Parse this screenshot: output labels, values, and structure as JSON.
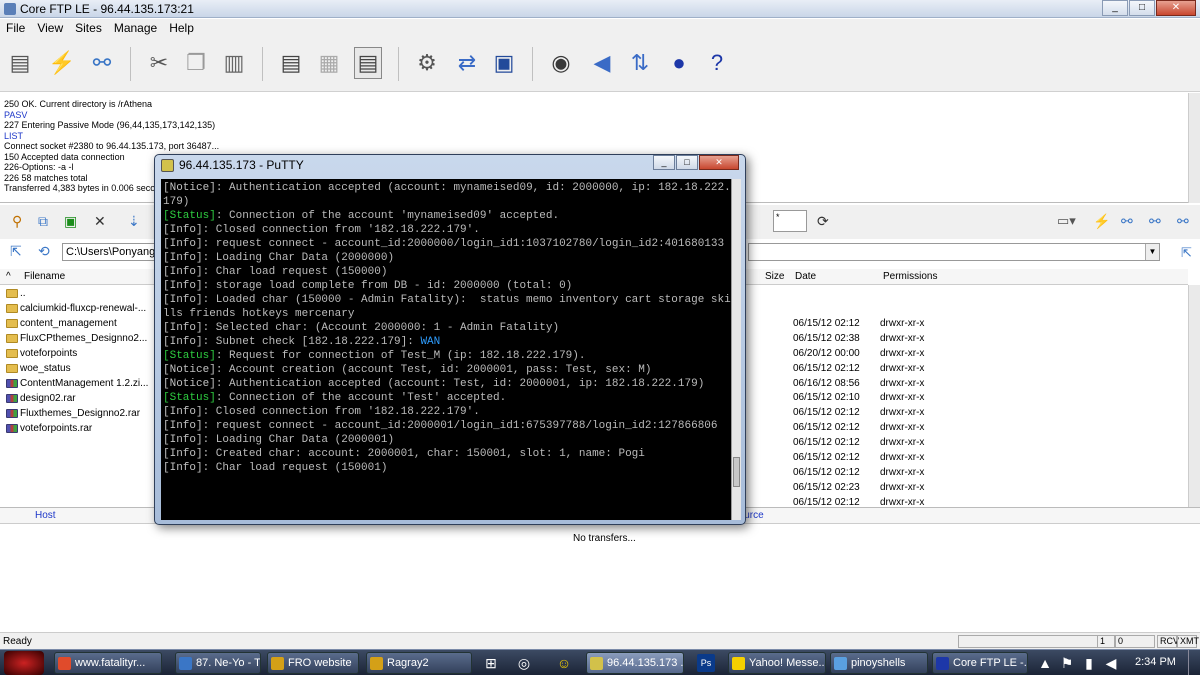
{
  "window": {
    "title": "Core FTP LE - 96.44.135.173:21"
  },
  "menu": [
    "File",
    "View",
    "Sites",
    "Manage",
    "Help"
  ],
  "toolbar_icons": [
    "site-manager-icon",
    "quick-connect-icon",
    "connect-icon",
    "cut-icon",
    "copy-icon",
    "paste-icon",
    "view-file-icon",
    "edit-file-icon",
    "list-icon",
    "settings-icon",
    "transfer-mode-icon",
    "terminal-icon",
    "view-icon",
    "sound-icon",
    "sync-icon",
    "options-icon",
    "help-icon"
  ],
  "log": [
    {
      "text": "250 OK. Current directory is /rAthena",
      "type": "resp"
    },
    {
      "text": "PASV",
      "type": "cmd"
    },
    {
      "text": "227 Entering Passive Mode (96,44,135,173,142,135)",
      "type": "resp"
    },
    {
      "text": "LIST",
      "type": "cmd"
    },
    {
      "text": "Connect socket #2380 to 96.44.135.173, port 36487...",
      "type": "resp"
    },
    {
      "text": "150 Accepted data connection",
      "type": "resp"
    },
    {
      "text": "226-Options: -a -l",
      "type": "resp"
    },
    {
      "text": "226 58 matches total",
      "type": "resp"
    },
    {
      "text": "Transferred 4,383 bytes in 0.006 seconds",
      "type": "resp"
    }
  ],
  "local": {
    "path": "C:\\Users\\Ponyang\\Desktop",
    "header": "Filename",
    "files": [
      {
        "name": "..",
        "kind": "folder"
      },
      {
        "name": "calciumkid-fluxcp-renewal-...",
        "kind": "folder"
      },
      {
        "name": "content_management",
        "kind": "folder"
      },
      {
        "name": "FluxCPthemes_Designno2...",
        "kind": "folder"
      },
      {
        "name": "voteforpoints",
        "kind": "folder"
      },
      {
        "name": "woe_status",
        "kind": "folder"
      },
      {
        "name": "ContentManagement 1.2.zi...",
        "kind": "rar"
      },
      {
        "name": "design02.rar",
        "kind": "rar"
      },
      {
        "name": "Fluxthemes_Designno2.rar",
        "kind": "rar"
      },
      {
        "name": "voteforpoints.rar",
        "kind": "rar"
      }
    ]
  },
  "remote": {
    "filter": "*",
    "headers": {
      "size": "Size",
      "date": "Date",
      "permissions": "Permissions"
    },
    "rows": [
      {
        "date": "06/15/12 02:12",
        "perm": "drwxr-xr-x"
      },
      {
        "date": "06/15/12 02:38",
        "perm": "drwxr-xr-x"
      },
      {
        "date": "06/20/12 00:00",
        "perm": "drwxr-xr-x"
      },
      {
        "date": "06/15/12 02:12",
        "perm": "drwxr-xr-x"
      },
      {
        "date": "06/16/12 08:56",
        "perm": "drwxr-xr-x"
      },
      {
        "date": "06/15/12 02:10",
        "perm": "drwxr-xr-x"
      },
      {
        "date": "06/15/12 02:12",
        "perm": "drwxr-xr-x"
      },
      {
        "date": "06/15/12 02:12",
        "perm": "drwxr-xr-x"
      },
      {
        "date": "06/15/12 02:12",
        "perm": "drwxr-xr-x"
      },
      {
        "date": "06/15/12 02:12",
        "perm": "drwxr-xr-x"
      },
      {
        "date": "06/15/12 02:12",
        "perm": "drwxr-xr-x"
      },
      {
        "date": "06/15/12 02:23",
        "perm": "drwxr-xr-x"
      },
      {
        "date": "06/15/12 02:12",
        "perm": "drwxr-xr-x"
      }
    ]
  },
  "transfers": {
    "host_label": "Host",
    "source_label": "Source",
    "empty_text": "No transfers..."
  },
  "status": {
    "ready": "Ready",
    "box1": "1",
    "box2": "0",
    "box3": "RCV",
    "box4": "XMT"
  },
  "putty": {
    "title": "96.44.135.173 - PuTTY",
    "lines": [
      {
        "tag": "[Notice]",
        "kind": "tag",
        "text": ": Authentication accepted (account: mynameised09, id: 2000000, ip: 182.18.222.179)"
      },
      {
        "tag": "[Status]",
        "kind": "status",
        "text": ": Connection of the account 'mynameised09' accepted."
      },
      {
        "tag": "[Info]",
        "kind": "tag",
        "text": ": Closed connection from '182.18.222.179'."
      },
      {
        "tag": "[Info]",
        "kind": "tag",
        "text": ": request connect - account_id:2000000/login_id1:1037102780/login_id2:401680133"
      },
      {
        "tag": "[Info]",
        "kind": "tag",
        "text": ": Loading Char Data (2000000)"
      },
      {
        "tag": "[Info]",
        "kind": "tag",
        "text": ": Char load request (150000)"
      },
      {
        "tag": "[Info]",
        "kind": "tag",
        "text": ": storage load complete from DB - id: 2000000 (total: 0)"
      },
      {
        "tag": "[Info]",
        "kind": "tag",
        "text": ": Loaded char (150000 - Admin Fatality):  status memo inventory cart storage skills friends hotkeys mercenary"
      },
      {
        "tag": "[Info]",
        "kind": "tag",
        "text": ": Selected char: (Account 2000000: 1 - Admin Fatality)"
      },
      {
        "tag": "[Info]",
        "kind": "tag",
        "text": ": Subnet check [182.18.222.179]: ",
        "wan": "WAN"
      },
      {
        "tag": "[Status]",
        "kind": "status",
        "text": ": Request for connection of Test_M (ip: 182.18.222.179)."
      },
      {
        "tag": "[Notice]",
        "kind": "tag",
        "text": ": Account creation (account Test, id: 2000001, pass: Test, sex: M)"
      },
      {
        "tag": "[Notice]",
        "kind": "tag",
        "text": ": Authentication accepted (account: Test, id: 2000001, ip: 182.18.222.179)"
      },
      {
        "tag": "[Status]",
        "kind": "status",
        "text": ": Connection of the account 'Test' accepted."
      },
      {
        "tag": "[Info]",
        "kind": "tag",
        "text": ": Closed connection from '182.18.222.179'."
      },
      {
        "tag": "[Info]",
        "kind": "tag",
        "text": ": request connect - account_id:2000001/login_id1:675397788/login_id2:127866806"
      },
      {
        "tag": "[Info]",
        "kind": "tag",
        "text": ": Loading Char Data (2000001)"
      },
      {
        "tag": "[Info]",
        "kind": "tag",
        "text": ": Created char: account: 2000001, char: 150001, slot: 1, name: Pogi"
      },
      {
        "tag": "[Info]",
        "kind": "tag",
        "text": ": Char load request (150001)"
      }
    ]
  },
  "taskbar": {
    "tasks": [
      {
        "label": "www.fatalityr...",
        "active": false
      },
      {
        "label": "87. Ne-Yo - T...",
        "active": false
      },
      {
        "label": "FRO website",
        "active": false
      },
      {
        "label": "Ragray2",
        "active": false
      },
      {
        "label": "96.44.135.173 ...",
        "active": true
      },
      {
        "label": "Yahoo! Messe...",
        "active": false
      },
      {
        "label": "pinoyshells",
        "active": false
      },
      {
        "label": "Core FTP LE -...",
        "active": false
      }
    ],
    "clock": "2:34 PM"
  }
}
